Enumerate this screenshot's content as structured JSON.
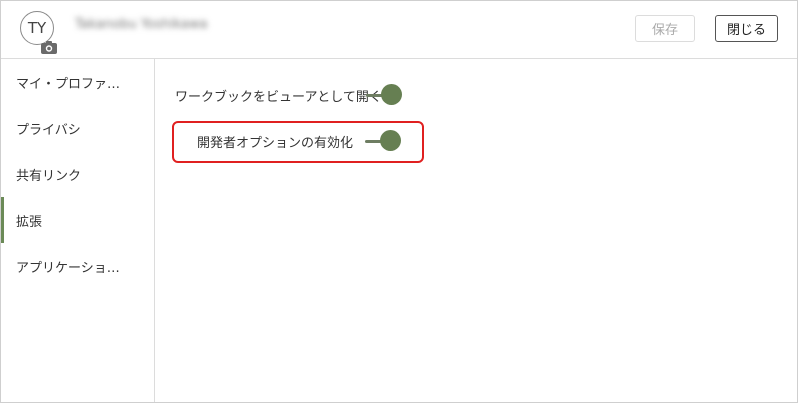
{
  "header": {
    "avatar_initials": "TY",
    "username": "Takanobu Yoshikawa",
    "save_label": "保存",
    "close_label": "閉じる"
  },
  "sidebar": {
    "items": [
      {
        "label": "マイ・プロファ…",
        "active": false
      },
      {
        "label": "プライバシ",
        "active": false
      },
      {
        "label": "共有リンク",
        "active": false
      },
      {
        "label": "拡張",
        "active": true
      },
      {
        "label": "アプリケーショ…",
        "active": false
      }
    ]
  },
  "content": {
    "settings": [
      {
        "label": "ワークブックをビューアとして開く",
        "enabled": true
      },
      {
        "label": "開発者オプションの有効化",
        "enabled": true,
        "highlighted": true
      }
    ]
  },
  "colors": {
    "accent": "#667f52",
    "highlight": "#e02020"
  }
}
